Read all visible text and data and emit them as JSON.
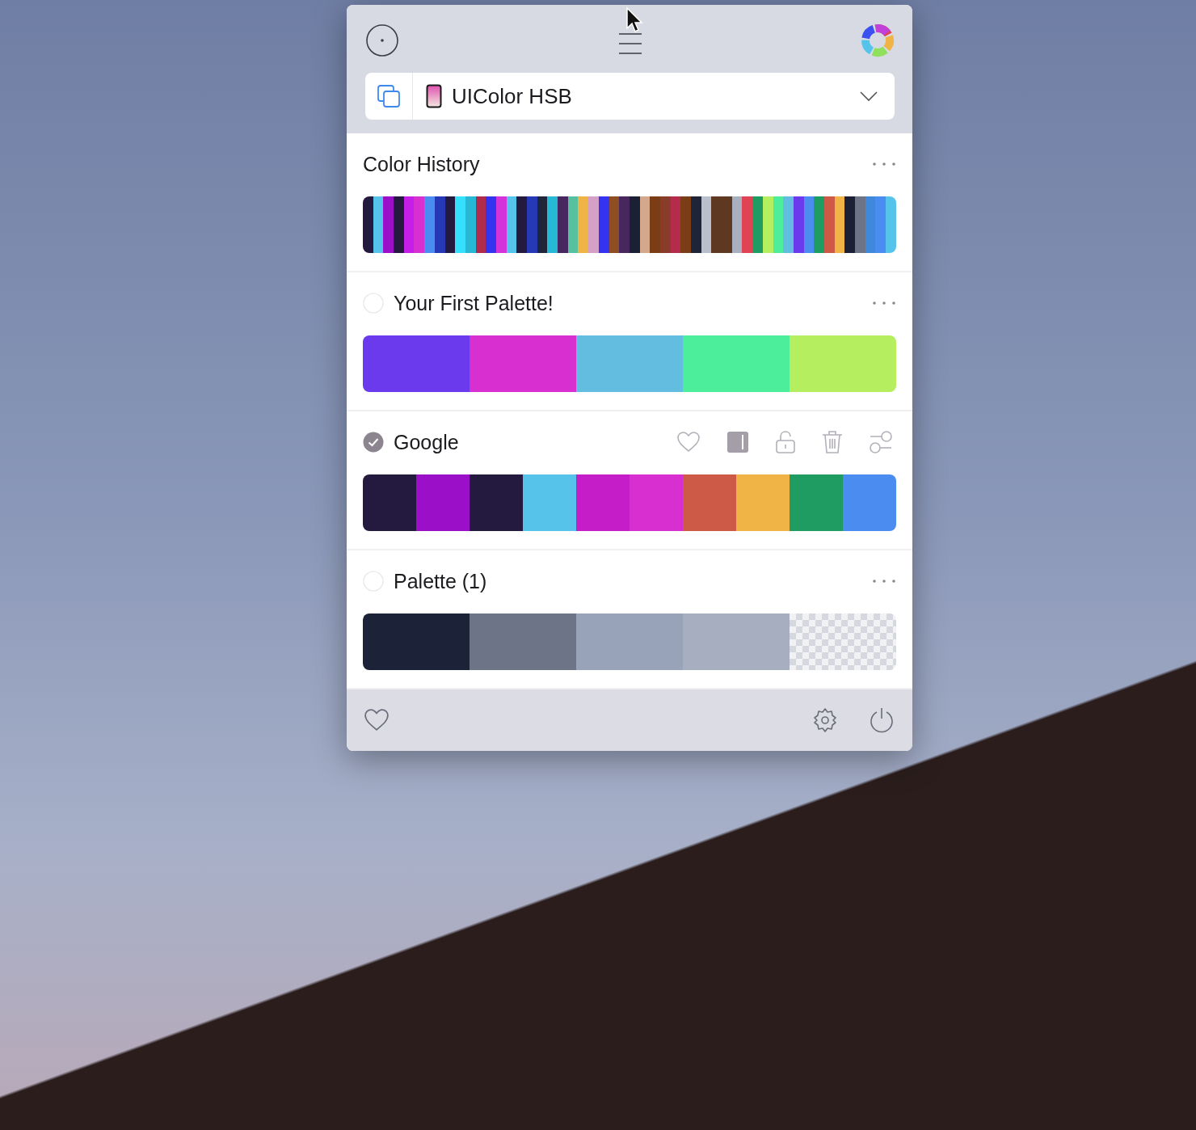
{
  "format_picker": {
    "value": "UIColor HSB"
  },
  "history": {
    "title": "Color History",
    "swatches": [
      {
        "color": "#241a40"
      },
      {
        "color": "#56c4ea"
      },
      {
        "color": "#9b0fc8"
      },
      {
        "color": "#241a40"
      },
      {
        "color": "#c51ee8"
      },
      {
        "color": "#d82fd0"
      },
      {
        "color": "#4a8cf0"
      },
      {
        "color": "#2538b5"
      },
      {
        "color": "#241a40"
      },
      {
        "color": "#34e0fc"
      },
      {
        "color": "#27b8d5"
      },
      {
        "color": "#b12b4c"
      },
      {
        "color": "#3333f0"
      },
      {
        "color": "#d333d8"
      },
      {
        "color": "#56c4ea"
      },
      {
        "color": "#241a40"
      },
      {
        "color": "#2538b5"
      },
      {
        "color": "#20263a"
      },
      {
        "color": "#27b8d5"
      },
      {
        "color": "#48265e"
      },
      {
        "color": "#57c09e"
      },
      {
        "color": "#f0b446"
      },
      {
        "color": "#d4a0c8"
      },
      {
        "color": "#3333f0"
      },
      {
        "color": "#8e4d22"
      },
      {
        "color": "#48265e"
      },
      {
        "color": "#1b2034"
      },
      {
        "color": "#d3a88c"
      },
      {
        "color": "#7a3d16"
      },
      {
        "color": "#8a3c2a"
      },
      {
        "color": "#b42b4c"
      },
      {
        "color": "#7a3d16"
      },
      {
        "color": "#1f2438"
      },
      {
        "color": "#b9c0cd"
      },
      {
        "color": "#5e3820"
      },
      {
        "color": "#5e3820"
      },
      {
        "color": "#a8b0bf"
      },
      {
        "color": "#e04454"
      },
      {
        "color": "#1e9c62"
      },
      {
        "color": "#b5ee5e"
      },
      {
        "color": "#4cee9c"
      },
      {
        "color": "#62bde0"
      },
      {
        "color": "#6a3aec"
      },
      {
        "color": "#4a8cf0"
      },
      {
        "color": "#1e9c62"
      },
      {
        "color": "#cc5a46"
      },
      {
        "color": "#f0b446"
      },
      {
        "color": "#1b2034"
      },
      {
        "color": "#6e7488"
      },
      {
        "color": "#3f88dc"
      },
      {
        "color": "#4a8cf0"
      },
      {
        "color": "#56c4ea"
      }
    ]
  },
  "palettes": [
    {
      "name": "Your First Palette!",
      "selected": false,
      "swatches": [
        {
          "kind": "solid",
          "color": "#6a3aec"
        },
        {
          "kind": "solid",
          "color": "#d82fd0"
        },
        {
          "kind": "solid",
          "color": "#62bde0"
        },
        {
          "kind": "solid",
          "color": "#4cee9c"
        },
        {
          "kind": "solid",
          "color": "#b5ee5e"
        }
      ]
    },
    {
      "name": "Google",
      "selected": true,
      "swatches": [
        {
          "kind": "solid",
          "color": "#241a40"
        },
        {
          "kind": "solid",
          "color": "#9b0fc8"
        },
        {
          "kind": "solid",
          "color": "#241a40"
        },
        {
          "kind": "solid",
          "color": "#56c4ea"
        },
        {
          "kind": "solid",
          "color": "#c51ec8"
        },
        {
          "kind": "solid",
          "color": "#d82fd0"
        },
        {
          "kind": "solid",
          "color": "#cc5a46"
        },
        {
          "kind": "solid",
          "color": "#f0b446"
        },
        {
          "kind": "solid",
          "color": "#1e9c62"
        },
        {
          "kind": "solid",
          "color": "#4a8cf0"
        }
      ]
    },
    {
      "name": "Palette (1)",
      "selected": false,
      "swatches": [
        {
          "kind": "solid",
          "color": "#1c2237"
        },
        {
          "kind": "solid",
          "color": "#6e7488"
        },
        {
          "kind": "solid",
          "color": "#98a2b8"
        },
        {
          "kind": "solid",
          "color": "#a6aec0"
        },
        {
          "kind": "transparent"
        }
      ]
    }
  ]
}
